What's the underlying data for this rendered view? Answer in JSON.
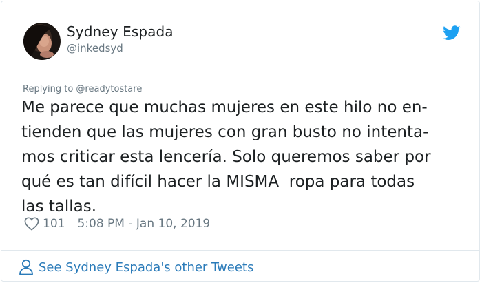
{
  "author": {
    "name": "Sydney Espada",
    "handle": "@inkedsyd",
    "avatar_icon": "avatar-photo"
  },
  "reply_to": "Replying to @readytostare",
  "tweet": {
    "lines": [
      "Me parece que muchas mujeres en este hilo no en-",
      "tienden que las mujeres con gran busto no intenta-",
      "mos criticar esta lencería. Solo queremos saber por",
      "qué es tan difícil hacer la MISMA  ropa para todas",
      "las tallas."
    ]
  },
  "meta": {
    "likes": "101",
    "timestamp": "5:08 PM - Jan 10, 2019",
    "heart_icon": "heart-outline-icon"
  },
  "footer": {
    "label": "See Sydney Espada's other Tweets",
    "icon": "person-outline-icon"
  },
  "brand": {
    "icon": "twitter-bird-icon",
    "color": "#1da1f2"
  },
  "colors": {
    "text": "#1c2022",
    "secondary": "#697882",
    "link": "#2b7bb9",
    "border": "#e1e8ed"
  }
}
